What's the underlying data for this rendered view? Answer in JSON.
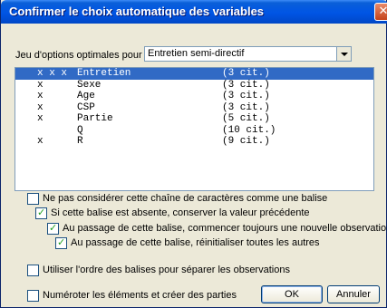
{
  "window": {
    "title": "Confirmer le choix automatique des variables",
    "close_glyph": "✕"
  },
  "options": {
    "label": "Jeu d'options optimales pour :",
    "selected": "Entretien semi-directif"
  },
  "variables": [
    {
      "mark": "x x x",
      "name": "Entretien",
      "count": "(3 cit.)"
    },
    {
      "mark": "x",
      "name": "Sexe",
      "count": "(3 cit.)"
    },
    {
      "mark": "x",
      "name": "Age",
      "count": "(3 cit.)"
    },
    {
      "mark": "x",
      "name": "CSP",
      "count": "(3 cit.)"
    },
    {
      "mark": "x",
      "name": "Partie",
      "count": "(5 cit.)"
    },
    {
      "mark": "",
      "name": "Q",
      "count": "(10 cit.)"
    },
    {
      "mark": "x",
      "name": "R",
      "count": "(9 cit.)"
    }
  ],
  "checkboxes": {
    "ignore_string": {
      "label": "Ne pas considérer cette chaîne de caractères comme une balise",
      "checked": false
    },
    "keep_previous": {
      "label": "Si cette balise est absente, conserver la valeur précédente",
      "checked": true
    },
    "new_observation": {
      "label": "Au passage de cette balise, commencer toujours une nouvelle observation",
      "checked": true
    },
    "reset_others": {
      "label": "Au passage de cette balise, réinitialiser toutes les autres",
      "checked": true
    },
    "use_order": {
      "label": "Utiliser l'ordre des balises pour séparer les observations",
      "checked": false
    },
    "number_elements": {
      "label": "Numéroter les éléments et créer des parties",
      "checked": false
    }
  },
  "buttons": {
    "ok": "OK",
    "cancel": "Annuler"
  }
}
